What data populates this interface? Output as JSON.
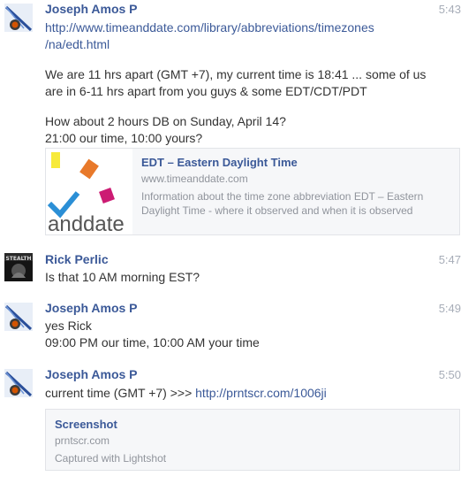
{
  "messages": [
    {
      "sender": "Joseph Amos P",
      "time": "5:43",
      "link_line1": "http://www.timeanddate.com/library/abbreviations/timezones",
      "link_line2": "/na/edt.html",
      "para1_line1": "We are 11 hrs apart (GMT +7), my current time is 18:41 ... some of us",
      "para1_line2": "are in 6-11 hrs apart from you guys & some EDT/CDT/PDT",
      "para2_line1": "How about 2 hours DB on Sunday, April 14?",
      "para2_line2": "21:00 our time, 10:00 yours?",
      "card": {
        "title": "EDT – Eastern Daylight Time",
        "domain": "www.timeanddate.com",
        "description": "Information about the time zone abbreviation EDT – Eastern Daylight Time - where it observed and when it is observed",
        "thumb_text": "anddate"
      }
    },
    {
      "sender": "Rick Perlic",
      "time": "5:47",
      "avatar_text": "STEALTH",
      "line1": "Is that 10 AM morning EST?"
    },
    {
      "sender": "Joseph Amos P",
      "time": "5:49",
      "line1": "yes Rick",
      "line2": "09:00 PM our time, 10:00 AM your time"
    },
    {
      "sender": "Joseph Amos P",
      "time": "5:50",
      "text_prefix": "current time (GMT +7) >>> ",
      "link": "http://prntscr.com/1006ji",
      "card": {
        "title": "Screenshot",
        "domain": "prntscr.com",
        "description": "Captured with Lightshot"
      }
    }
  ],
  "colors": {
    "link": "#3b5998",
    "timestamp": "#a7adb8",
    "card_bg": "#f6f7f9"
  }
}
